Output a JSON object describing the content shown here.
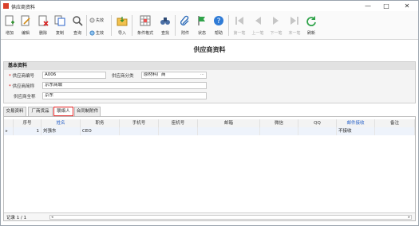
{
  "window": {
    "title": "供应商资料",
    "controls": {
      "minimize": "—",
      "maximize": "□",
      "close": "✕"
    }
  },
  "toolbar": {
    "add": "增加",
    "edit": "编辑",
    "delete": "删除",
    "copy": "复制",
    "query": "查询",
    "invalidate": "失效",
    "activate": "生效",
    "import": "导入",
    "condition_format": "条件格式",
    "find_replace": "查找",
    "attachment": "附件",
    "status": "状态",
    "help": "帮助",
    "first": "第一笔",
    "prev": "上一笔",
    "next": "下一笔",
    "last": "末一笔",
    "refresh": "刷新"
  },
  "form": {
    "title": "供应商资料",
    "section_title": "基本资料",
    "supplier_code_label": "供应商编号",
    "supplier_code_value": "A006",
    "supplier_category_label": "供应商分类",
    "supplier_category_value": "原材料厂商",
    "supplier_short_label": "供应商简称",
    "supplier_short_value": "京东商城",
    "supplier_full_label": "供应商全称",
    "supplier_full_value": "京东",
    "required_mark": "*"
  },
  "tabs": [
    {
      "label": "交易资料"
    },
    {
      "label": "厂商货品"
    },
    {
      "label": "联络人"
    },
    {
      "label": "合同制附件"
    }
  ],
  "grid": {
    "columns": [
      "序号",
      "姓名",
      "职务",
      "手机号",
      "座机号",
      "邮箱",
      "微信",
      "QQ",
      "邮件接收",
      "备注"
    ],
    "rows": [
      {
        "row_marker": "▸",
        "seq": "1",
        "name": "刘强东",
        "title": "CEO",
        "mobile": "",
        "phone": "",
        "email": "",
        "wechat": "",
        "qq": "",
        "mail_receive": "不接收",
        "remark": ""
      }
    ],
    "record_text": "记录 1 / 1",
    "nav_prev": "◂",
    "nav_next": "▸"
  },
  "colors": {
    "accent_blue": "#2962c9",
    "active_tab_border": "#e02020"
  }
}
